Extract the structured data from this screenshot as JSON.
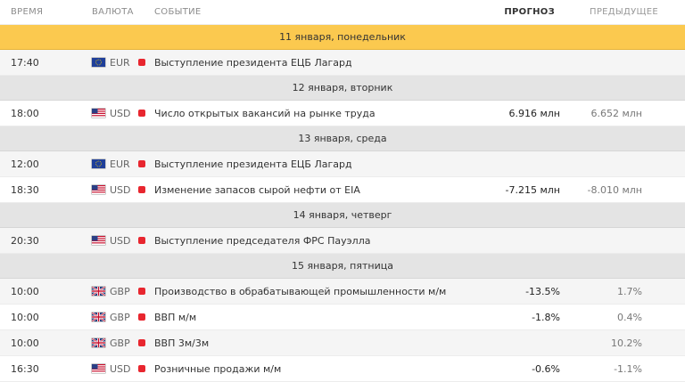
{
  "header": {
    "time": "ВРЕМЯ",
    "currency": "ВАЛЮТА",
    "event": "СОБЫТИЕ",
    "forecast": "ПРОГНОЗ",
    "previous": "ПРЕДЫДУЩЕЕ"
  },
  "days": [
    {
      "date": "11 января, понедельник",
      "events": [
        {
          "time": "17:40",
          "currency": "EUR",
          "flag": "eu-flag-icon",
          "impact": "high",
          "event": "Выступление президента ЕЦБ Лагард",
          "forecast": "",
          "previous": ""
        }
      ]
    },
    {
      "date": "12 января, вторник",
      "events": [
        {
          "time": "18:00",
          "currency": "USD",
          "flag": "us-flag-icon",
          "impact": "high",
          "event": "Число открытых вакансий на рынке труда",
          "forecast": "6.916 млн",
          "previous": "6.652 млн"
        }
      ]
    },
    {
      "date": "13 января, среда",
      "events": [
        {
          "time": "12:00",
          "currency": "EUR",
          "flag": "eu-flag-icon",
          "impact": "high",
          "event": "Выступление президента ЕЦБ Лагард",
          "forecast": "",
          "previous": ""
        },
        {
          "time": "18:30",
          "currency": "USD",
          "flag": "us-flag-icon",
          "impact": "high",
          "event": "Изменение запасов сырой нефти от EIA",
          "forecast": "-7.215 млн",
          "previous": "-8.010 млн"
        }
      ]
    },
    {
      "date": "14 января, четверг",
      "events": [
        {
          "time": "20:30",
          "currency": "USD",
          "flag": "us-flag-icon",
          "impact": "high",
          "event": "Выступление председателя ФРС Пауэлла",
          "forecast": "",
          "previous": ""
        }
      ]
    },
    {
      "date": "15 января, пятница",
      "events": [
        {
          "time": "10:00",
          "currency": "GBP",
          "flag": "uk-flag-icon",
          "impact": "high",
          "event": "Производство в обрабатывающей промышленности м/м",
          "forecast": "-13.5%",
          "previous": "1.7%"
        },
        {
          "time": "10:00",
          "currency": "GBP",
          "flag": "uk-flag-icon",
          "impact": "high",
          "event": "ВВП м/м",
          "forecast": "-1.8%",
          "previous": "0.4%"
        },
        {
          "time": "10:00",
          "currency": "GBP",
          "flag": "uk-flag-icon",
          "impact": "high",
          "event": "ВВП 3м/3м",
          "forecast": "",
          "previous": "10.2%"
        },
        {
          "time": "16:30",
          "currency": "USD",
          "flag": "us-flag-icon",
          "impact": "high",
          "event": "Розничные продажи м/м",
          "forecast": "-0.6%",
          "previous": "-1.1%"
        }
      ]
    }
  ],
  "colors": {
    "first_date_bg": "#fbc94f",
    "date_bg": "#e4e4e4",
    "impact_high": "#e8262f"
  }
}
